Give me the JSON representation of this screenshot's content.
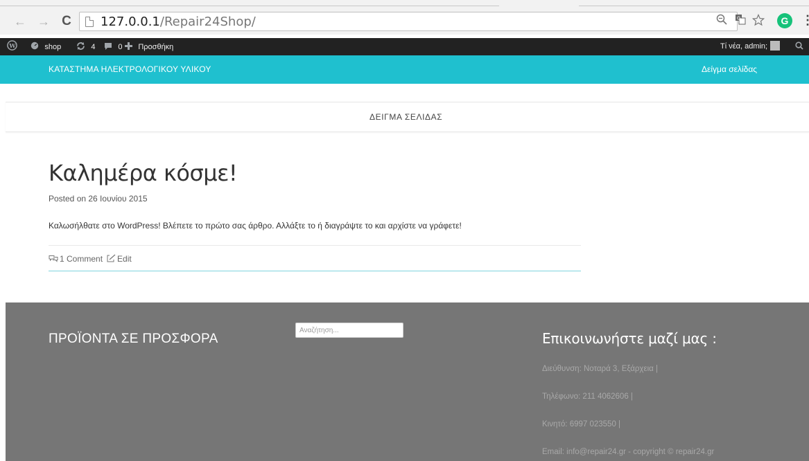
{
  "browser": {
    "url_host": "127.0.0.1",
    "url_path": "/Repair24Shop/",
    "back_glyph": "←",
    "forward_glyph": "→",
    "reload_glyph": "C",
    "extension_letter": "G",
    "menu_glyph": "⋮",
    "icons": [
      "back-arrow-icon",
      "forward-arrow-icon",
      "reload-icon",
      "page-icon",
      "zoom-icon",
      "translate-icon",
      "star-icon",
      "grammarly-icon",
      "menu-icon"
    ]
  },
  "admin_bar": {
    "site_name": "shop",
    "updates_count": "4",
    "comments_count": "0",
    "new_label": "Προσθήκη",
    "greeting": "Τί νέα, admin;"
  },
  "header": {
    "site_title": "ΚΑΤΑΣΤΗΜΑ ΗΛΕΚΤΡΟΛΟΓΙΚΟΥ ΥΛΙΚΟΥ",
    "nav_link": "Δείγμα σελίδας",
    "bg_color": "#1fc0cf"
  },
  "sub_nav": {
    "link": "ΔΕΙΓΜΑ ΣΕΛΙΔΑΣ"
  },
  "post": {
    "title": "Καλημέρα κόσμε!",
    "meta": "Posted on 26 Ιουνίου 2015",
    "content": "Καλωσήλθατε στο WordPress! Βλέπετε το πρώτο σας άρθρο. Αλλάξτε το ή διαγράψτε το και αρχίστε να γράφετε!",
    "comment_link": "1 Comment",
    "edit_link": "Edit"
  },
  "footer": {
    "left_heading": "ΠΡΟΪΟΝΤΑ ΣΕ ΠΡΟΣΦΟΡΑ",
    "search_placeholder": "Αναζήτηση...",
    "right_heading": "Επικοινωνήστε μαζί μας :",
    "address": "Διεύθυνση: Νοταρά 3, Εξάρχεια |",
    "phone": "Τηλέφωνο: 211 4062606 |",
    "mobile": "Κινητό: 6997 023550 |",
    "email": "Email: info@repair24.gr - copyright © repair24.gr",
    "bg_color": "#767676"
  }
}
